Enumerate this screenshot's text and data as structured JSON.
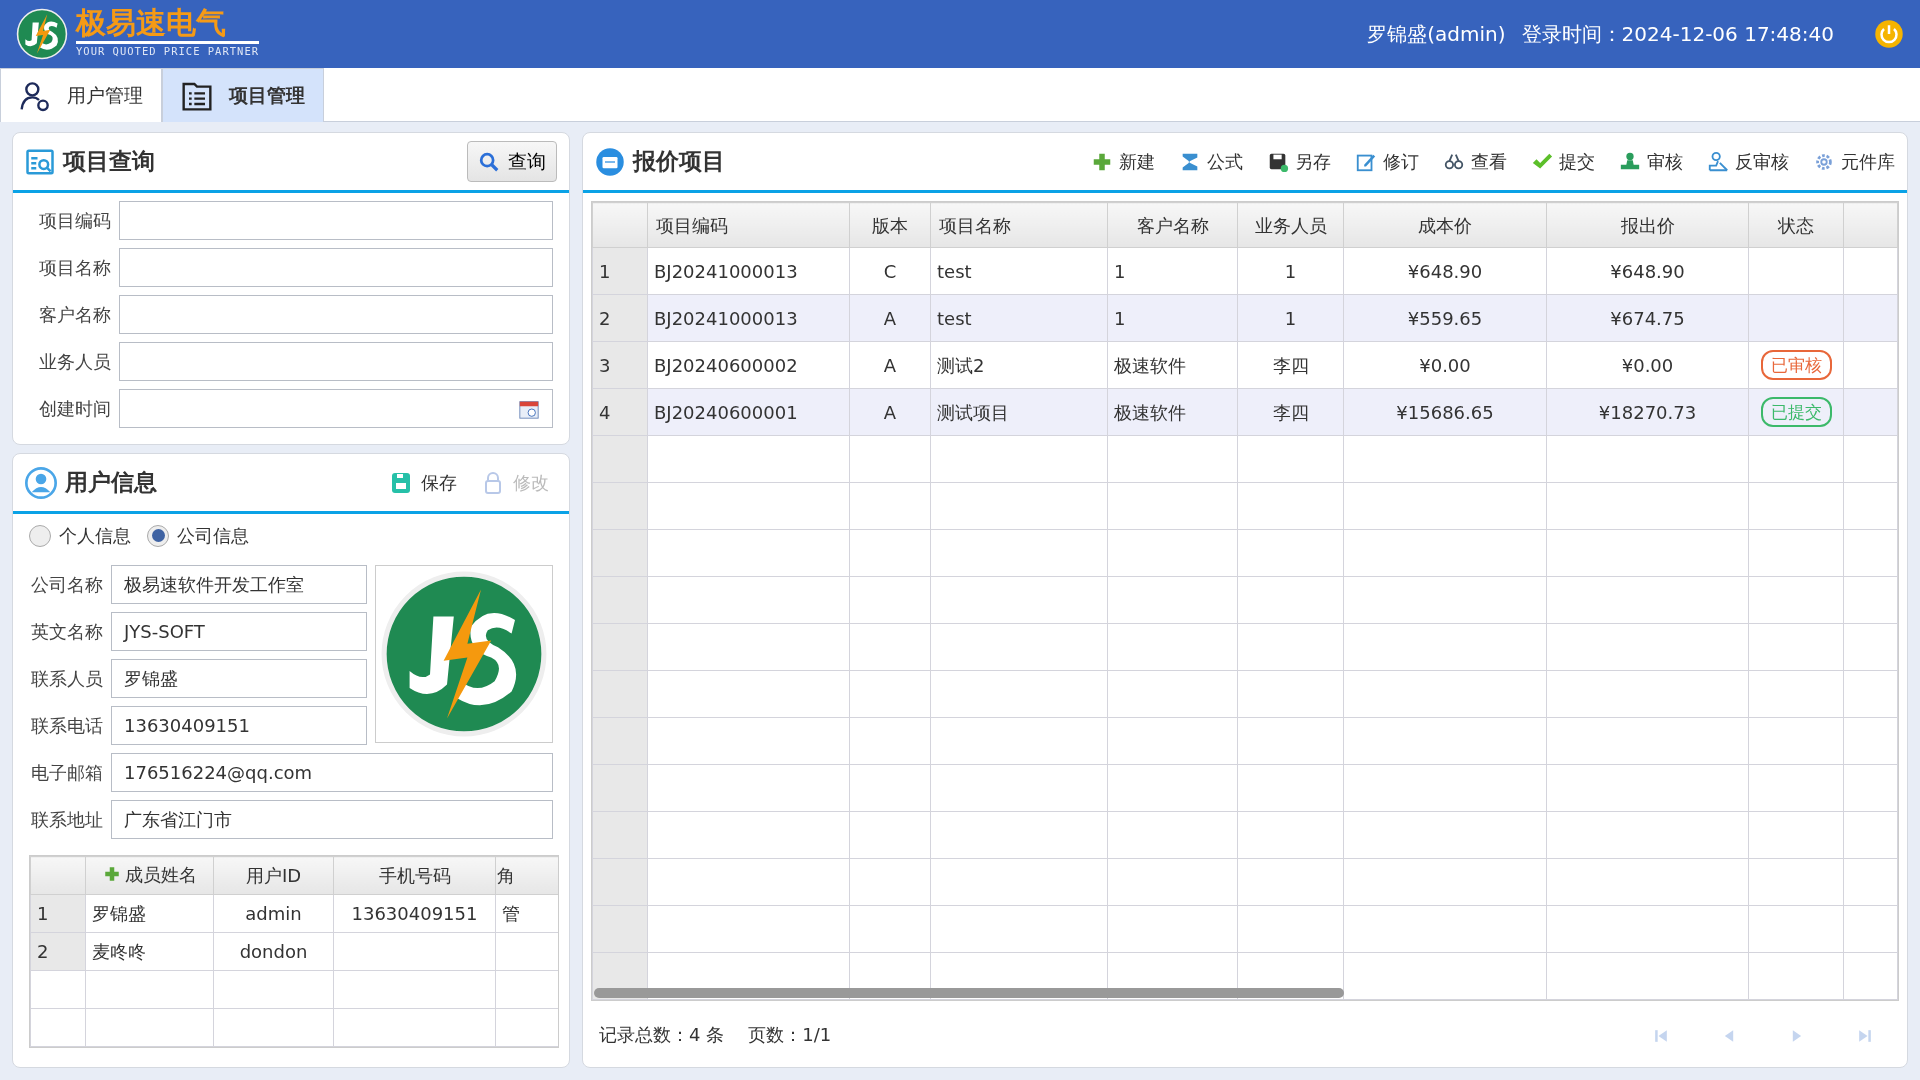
{
  "header": {
    "brand": "极易速电气",
    "slogan": "YOUR QUOTED PRICE PARTNER",
    "user": "罗锦盛(admin)",
    "login_label": "登录时间：",
    "login_time": "2024-12-06 17:48:40"
  },
  "tabs": [
    {
      "label": "用户管理",
      "kind": "user",
      "selected": false
    },
    {
      "label": "项目管理",
      "kind": "list",
      "selected": true
    }
  ],
  "query_panel": {
    "title": "项目查询",
    "button": "查询",
    "fields": [
      {
        "label": "项目编码",
        "kind": "text"
      },
      {
        "label": "项目名称",
        "kind": "text"
      },
      {
        "label": "客户名称",
        "kind": "text"
      },
      {
        "label": "业务人员",
        "kind": "text"
      },
      {
        "label": "创建时间",
        "kind": "date"
      }
    ]
  },
  "user_panel": {
    "title": "用户信息",
    "actions": [
      {
        "label": "保存",
        "kind": "save",
        "disabled": false
      },
      {
        "label": "修改",
        "kind": "lock",
        "disabled": true
      }
    ],
    "radios": [
      {
        "label": "个人信息",
        "selected": false
      },
      {
        "label": "公司信息",
        "selected": true
      }
    ],
    "fields": [
      {
        "label": "公司名称",
        "value": "极易速软件开发工作室"
      },
      {
        "label": "英文名称",
        "value": "JYS-SOFT"
      },
      {
        "label": "联系人员",
        "value": "罗锦盛"
      },
      {
        "label": "联系电话",
        "value": "13630409151"
      },
      {
        "label": "电子邮箱",
        "value": "176516224@qq.com"
      },
      {
        "label": "联系地址",
        "value": "广东省江门市"
      }
    ],
    "members": {
      "columns": [
        "成员姓名",
        "用户ID",
        "手机号码",
        "角"
      ],
      "rows": [
        {
          "index": "1",
          "cells": [
            "罗锦盛",
            "admin",
            "13630409151",
            "管"
          ]
        },
        {
          "index": "2",
          "cells": [
            "麦咚咚",
            "dondon",
            "",
            ""
          ]
        }
      ]
    }
  },
  "quote_panel": {
    "title": "报价项目",
    "toolbar": [
      {
        "label": "新建",
        "kind": "plus"
      },
      {
        "label": "公式",
        "kind": "sigma"
      },
      {
        "label": "另存",
        "kind": "disk"
      },
      {
        "label": "修订",
        "kind": "edit"
      },
      {
        "label": "查看",
        "kind": "view"
      },
      {
        "label": "提交",
        "kind": "check"
      },
      {
        "label": "审核",
        "kind": "stamp"
      },
      {
        "label": "反审核",
        "kind": "unstamp"
      },
      {
        "label": "元件库",
        "kind": "gear"
      }
    ],
    "columns": [
      "项目编码",
      "版本",
      "项目名称",
      "客户名称",
      "业务人员",
      "成本价",
      "报出价",
      "状态"
    ],
    "rows": [
      {
        "index": "1",
        "code": "BJ20241000013",
        "version": "C",
        "name": "test",
        "customer": "1",
        "sales": "1",
        "cost": "¥648.90",
        "quote": "¥648.90"
      },
      {
        "index": "2",
        "code": "BJ20241000013",
        "version": "A",
        "name": "test",
        "customer": "1",
        "sales": "1",
        "cost": "¥559.65",
        "quote": "¥674.75"
      },
      {
        "index": "3",
        "code": "BJ20240600002",
        "version": "A",
        "name": "测试2",
        "customer": "极速软件",
        "sales": "李四",
        "cost": "¥0.00",
        "quote": "¥0.00",
        "status": {
          "text": "已审核",
          "color": "#e8673a"
        }
      },
      {
        "index": "4",
        "code": "BJ20240600001",
        "version": "A",
        "name": "测试项目",
        "customer": "极速软件",
        "sales": "李四",
        "cost": "¥15686.65",
        "quote": "¥18270.73",
        "status": {
          "text": "已提交",
          "color": "#3cb96a"
        }
      }
    ],
    "footer": {
      "total": "记录总数：4 条",
      "pages": "页数：1/1"
    },
    "pager": [
      {
        "kind": "first",
        "disabled": true
      },
      {
        "kind": "prev",
        "disabled": true
      },
      {
        "kind": "next",
        "disabled": true
      },
      {
        "kind": "last",
        "disabled": true
      }
    ]
  }
}
